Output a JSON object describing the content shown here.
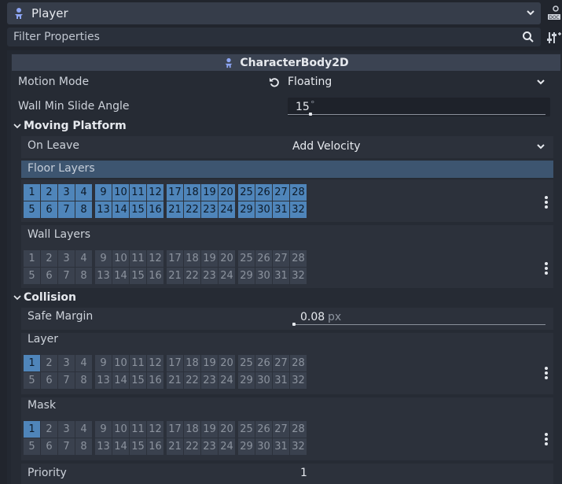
{
  "node": {
    "name": "Player"
  },
  "filter": {
    "placeholder": "Filter Properties"
  },
  "class_name": "CharacterBody2D",
  "properties": {
    "motion_mode": {
      "label": "Motion Mode",
      "value": "Floating"
    },
    "wall_min_slide_angle": {
      "label": "Wall Min Slide Angle",
      "value": "15",
      "unit": "°"
    },
    "moving_platform": {
      "header": "Moving Platform",
      "on_leave": {
        "label": "On Leave",
        "value": "Add Velocity"
      },
      "floor_layers": {
        "label": "Floor Layers",
        "enabled": [
          1,
          2,
          3,
          4,
          5,
          6,
          7,
          8,
          9,
          10,
          11,
          12,
          13,
          14,
          15,
          16,
          17,
          18,
          19,
          20,
          21,
          22,
          23,
          24,
          25,
          26,
          27,
          28,
          29,
          30,
          31,
          32
        ]
      },
      "wall_layers": {
        "label": "Wall Layers",
        "enabled": []
      }
    },
    "collision": {
      "header": "Collision",
      "safe_margin": {
        "label": "Safe Margin",
        "value": "0.08",
        "unit": "px"
      },
      "layer": {
        "label": "Layer",
        "enabled": [
          1
        ]
      },
      "mask": {
        "label": "Mask",
        "enabled": [
          1
        ]
      },
      "priority": {
        "label": "Priority",
        "value": "1"
      }
    }
  },
  "colors": {
    "accent": "#4f85ba",
    "header_bg": "#3b4352",
    "selected_row": "#3d5570"
  }
}
